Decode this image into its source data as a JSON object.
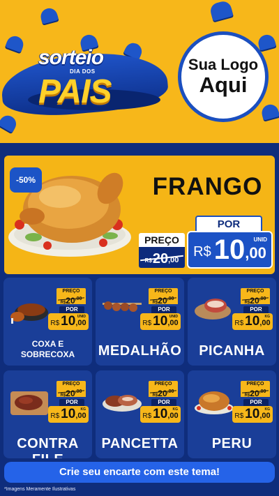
{
  "header": {
    "brand_top": "sorteio",
    "brand_sub": "DIA DOS",
    "brand_main": "PAIS",
    "logo_line1": "Sua Logo",
    "logo_line2": "Aqui"
  },
  "featured": {
    "discount": "-50%",
    "name": "FRANGO",
    "preco_label": "PREÇO",
    "old_currency": "R$",
    "old_int": "20",
    "old_dec": ",00",
    "por_label": "POR",
    "new_currency": "R$",
    "new_int": "10",
    "new_dec": ",00",
    "unit": "UNID"
  },
  "products": [
    {
      "name": "COXA E SOBRECOXA",
      "preco_label": "PREÇO",
      "old_currency": "R$",
      "old_int": "20",
      "old_dec": ",00",
      "por_label": "POR",
      "currency": "R$",
      "int": "10",
      "dec": ",00",
      "unit": "UNID"
    },
    {
      "name": "MEDALHÃO",
      "preco_label": "PREÇO",
      "old_currency": "R$",
      "old_int": "20",
      "old_dec": ",00",
      "por_label": "POR",
      "currency": "R$",
      "int": "10",
      "dec": ",00",
      "unit": "UNID"
    },
    {
      "name": "PICANHA",
      "preco_label": "PREÇO",
      "old_currency": "R$",
      "old_int": "20",
      "old_dec": ",00",
      "por_label": "POR",
      "currency": "R$",
      "int": "10",
      "dec": ",00",
      "unit": "KG"
    },
    {
      "name": "CONTRA FILE",
      "preco_label": "PREÇO",
      "old_currency": "R$",
      "old_int": "20",
      "old_dec": ",00",
      "por_label": "POR",
      "currency": "R$",
      "int": "10",
      "dec": ",00",
      "unit": "KG"
    },
    {
      "name": "PANCETTA",
      "preco_label": "PREÇO",
      "old_currency": "R$",
      "old_int": "20",
      "old_dec": ",00",
      "por_label": "POR",
      "currency": "R$",
      "int": "10",
      "dec": ",00",
      "unit": "KG"
    },
    {
      "name": "PERU",
      "preco_label": "PREÇO",
      "old_currency": "R$",
      "old_int": "20",
      "old_dec": ",00",
      "por_label": "POR",
      "currency": "R$",
      "int": "10",
      "dec": ",00",
      "unit": "KG"
    }
  ],
  "cta": "Crie seu encarte com este tema!",
  "disclaimer": "*Imagens Meramente Ilustrativas",
  "colors": {
    "yellow": "#f7b71a",
    "navy": "#0f2d7c",
    "blue": "#1c52c5",
    "card": "#1a3e98"
  }
}
